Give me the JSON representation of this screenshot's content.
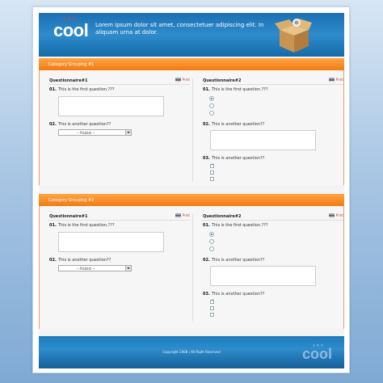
{
  "header": {
    "logo_inc": "inc",
    "logo_cool": "cool",
    "tagline": "Lorem ipsum dolor sit amet, consectetuer adipiscing elit. In aliquam urna at dolor."
  },
  "groups": [
    {
      "title": "Category Grouping #1",
      "left": {
        "title": "Questionnaire#1",
        "print": "Print",
        "q1_num": "01.",
        "q1_text": "This is the first question.???",
        "q2_num": "02.",
        "q2_text": "This is another question??",
        "picklist": "-- Picklist --"
      },
      "right": {
        "title": "Questionnaire#2",
        "print": "Print",
        "q1_num": "01.",
        "q1_text": "This is the first question.???",
        "q2_num": "02.",
        "q2_text": "This is another question??",
        "q3_num": "03.",
        "q3_text": "This is another question??"
      }
    },
    {
      "title": "Category Grouping #2",
      "left": {
        "title": "Questionnaire#1",
        "print": "Print",
        "q1_num": "01.",
        "q1_text": "This is the first question.???",
        "q2_num": "02.",
        "q2_text": "This is another question??",
        "picklist": "-- Picklist --"
      },
      "right": {
        "title": "Questionnaire#2",
        "print": "Print",
        "q1_num": "01.",
        "q1_text": "This is the first question.???",
        "q2_num": "02.",
        "q2_text": "This is another question??",
        "q3_num": "03.",
        "q3_text": "This is another question??"
      }
    }
  ],
  "footer": {
    "copyright": "Copyright 2008 | All Right Reserved",
    "logo_inc": "inc",
    "logo_cool": "cool"
  },
  "colors": {
    "accent": "#f27a12",
    "header_blue": "#2e8ccc"
  }
}
